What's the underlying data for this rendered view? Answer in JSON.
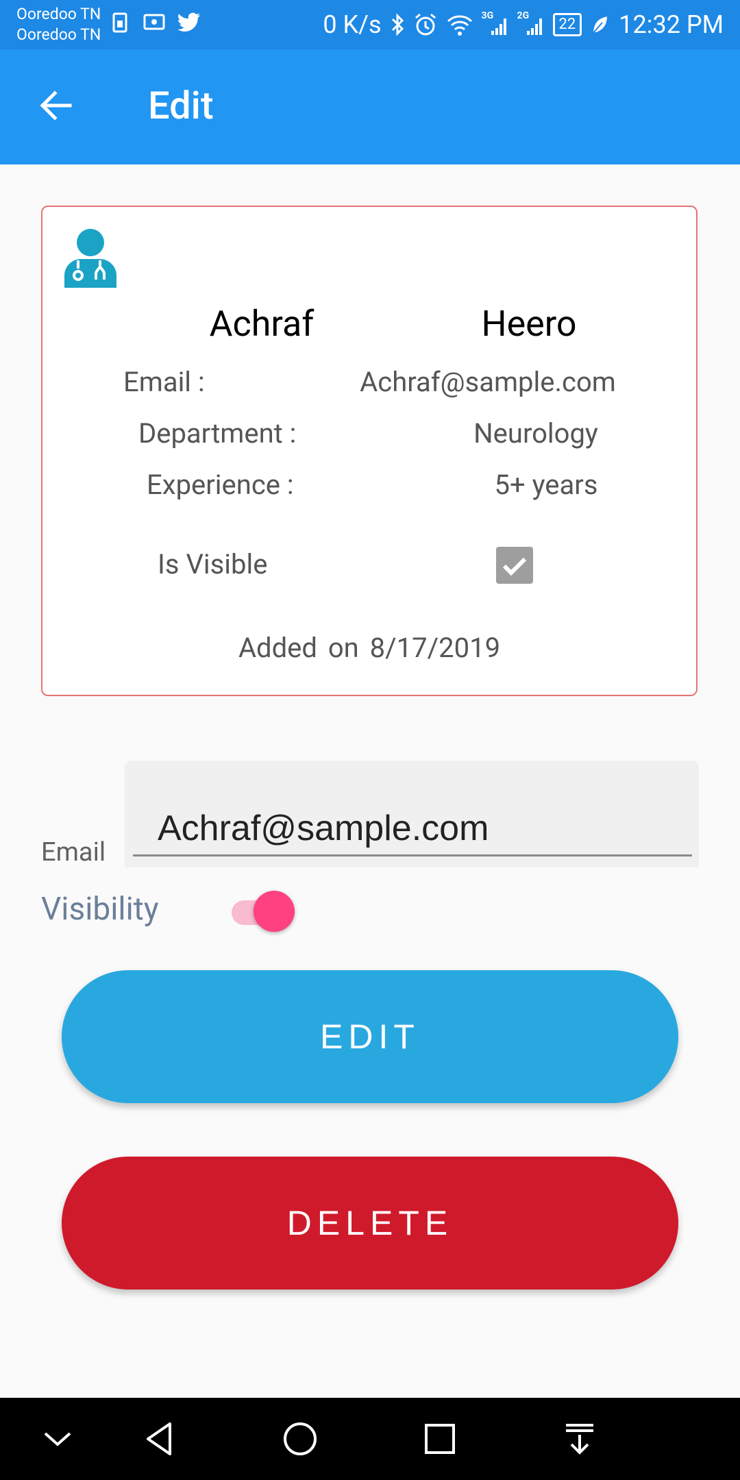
{
  "status_bar": {
    "carrier_1": "Ooredoo TN",
    "carrier_2": "Ooredoo TN",
    "net_speed": "0 K/s",
    "net_3g": "3G",
    "net_2g": "2G",
    "battery": "22",
    "time": "12:32 PM",
    "icons": [
      "sim-icon",
      "screen-icon",
      "twitter-icon",
      "bluetooth-icon",
      "alarm-icon",
      "wifi-icon",
      "signal-icon",
      "battery-icon",
      "leaf-icon"
    ]
  },
  "app_bar": {
    "title": "Edit",
    "back_icon": "arrow-back-icon",
    "color": "#2196f3"
  },
  "card": {
    "icon": "doctor-icon",
    "first_name": "Achraf",
    "last_name": "Heero",
    "email_label": "Email :",
    "email_value": "Achraf@sample.com",
    "department_label": "Department :",
    "department_value": "Neurology",
    "experience_label": "Experience :",
    "experience_value": "5+ years",
    "visible_label": "Is Visible",
    "visible_checked": true,
    "added_label": "Added on",
    "added_date": "8/17/2019",
    "border_color": "#e57373"
  },
  "form": {
    "email_label": "Email",
    "email_value": "Achraf@sample.com",
    "visibility_label": "Visibility",
    "visibility_on": true
  },
  "buttons": {
    "edit_label": "EDIT",
    "edit_color": "#29a8e0",
    "delete_label": "DELETE",
    "delete_color": "#cf1a2b"
  },
  "nav_bar": {
    "icons": [
      "chevron-down-icon",
      "back-triangle-icon",
      "home-circle-icon",
      "recents-square-icon",
      "notification-pull-icon"
    ]
  }
}
